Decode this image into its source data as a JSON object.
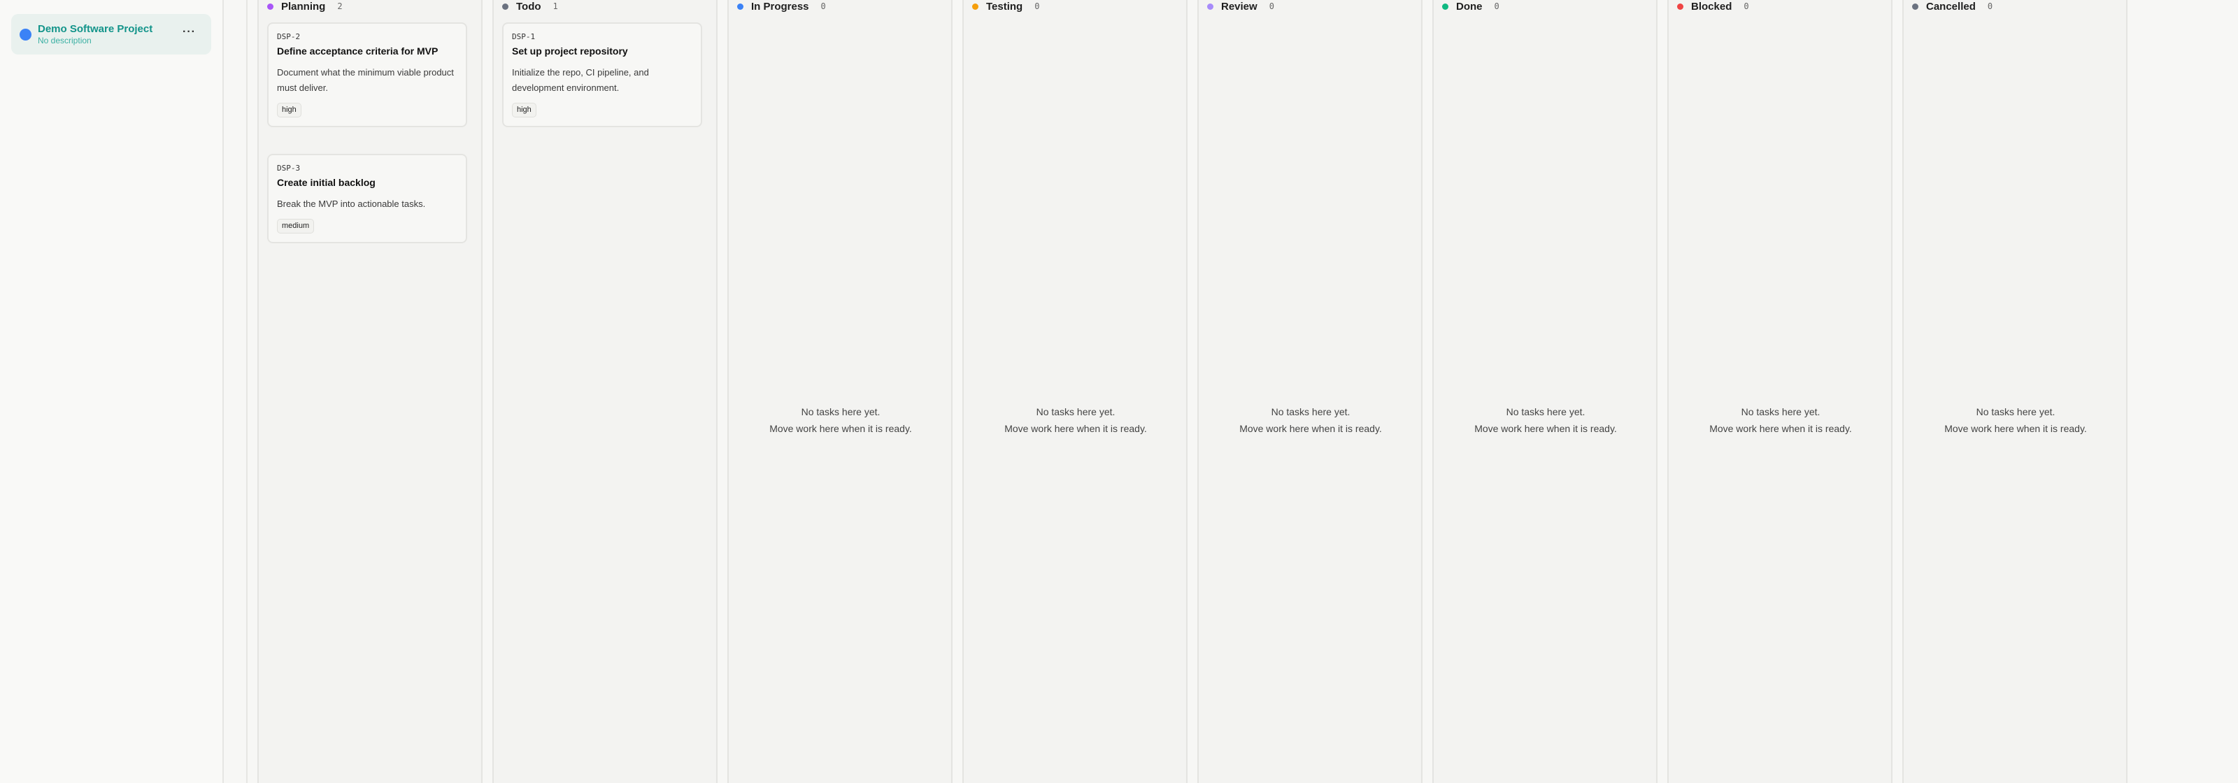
{
  "sidebar": {
    "project": {
      "name": "Demo Software Project",
      "description": "No description",
      "menu_label": "···",
      "dot_color": "#3b82f6"
    }
  },
  "board": {
    "empty_state": {
      "line1": "No tasks here yet.",
      "line2": "Move work here when it is ready."
    },
    "columns": [
      {
        "title": "Planning",
        "count": "2",
        "dot_color": "#a855f7",
        "cards": [
          {
            "key": "DSP-2",
            "title": "Define acceptance criteria for MVP",
            "description": "Document what the minimum viable product must deliver.",
            "priority": "high"
          },
          {
            "key": "DSP-3",
            "title": "Create initial backlog",
            "description": "Break the MVP into actionable tasks.",
            "priority": "medium"
          }
        ]
      },
      {
        "title": "Todo",
        "count": "1",
        "dot_color": "#6b7280",
        "cards": [
          {
            "key": "DSP-1",
            "title": "Set up project repository",
            "description": "Initialize the repo, CI pipeline, and development environment.",
            "priority": "high"
          }
        ]
      },
      {
        "title": "In Progress",
        "count": "0",
        "dot_color": "#3b82f6",
        "cards": []
      },
      {
        "title": "Testing",
        "count": "0",
        "dot_color": "#f59e0b",
        "cards": []
      },
      {
        "title": "Review",
        "count": "0",
        "dot_color": "#a78bfa",
        "cards": []
      },
      {
        "title": "Done",
        "count": "0",
        "dot_color": "#10b981",
        "cards": []
      },
      {
        "title": "Blocked",
        "count": "0",
        "dot_color": "#ef4444",
        "cards": []
      },
      {
        "title": "Cancelled",
        "count": "0",
        "dot_color": "#6b7280",
        "cards": []
      }
    ]
  }
}
